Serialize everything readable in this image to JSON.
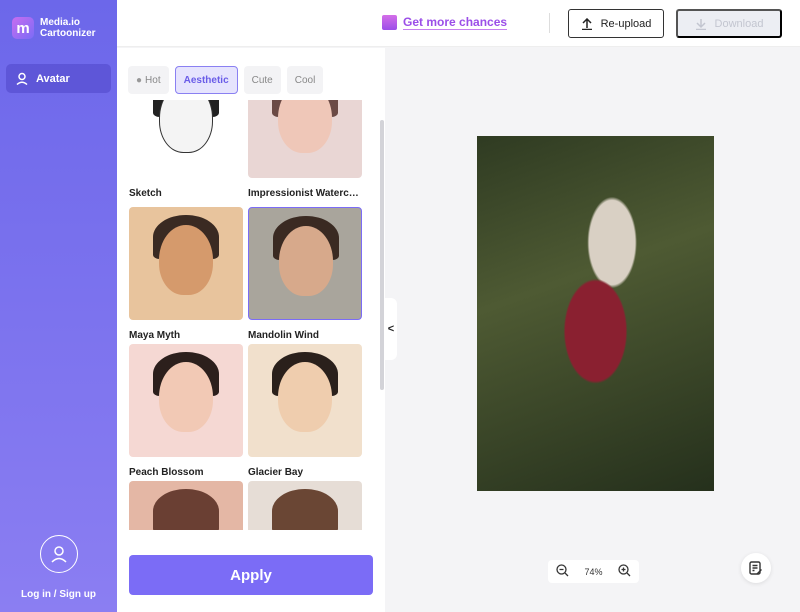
{
  "app": {
    "name_line1": "Media.io",
    "name_line2": "Cartoonizer",
    "logo_letter": "m"
  },
  "sidebar": {
    "items": [
      {
        "label": "Avatar",
        "icon": "user-icon"
      }
    ],
    "login_label": "Log in / Sign up"
  },
  "header": {
    "chances_label": "Get more chances",
    "reupload_label": "Re-upload",
    "download_label": "Download"
  },
  "tabs": [
    {
      "label": "Hot",
      "icon": "flame-icon"
    },
    {
      "label": "Aesthetic",
      "active": true
    },
    {
      "label": "Cute"
    },
    {
      "label": "Cool"
    }
  ],
  "styles": [
    {
      "label": "Sketch"
    },
    {
      "label": "Impressionist Watercolor"
    },
    {
      "label": "Maya Myth"
    },
    {
      "label": "Mandolin Wind",
      "selected": true
    },
    {
      "label": "Peach Blossom"
    },
    {
      "label": "Glacier Bay"
    },
    {
      "label": ""
    },
    {
      "label": ""
    }
  ],
  "apply_label": "Apply",
  "zoom_level": "74%",
  "colors": {
    "accent": "#7b6cf6",
    "sidebar": "#6c67ea"
  }
}
